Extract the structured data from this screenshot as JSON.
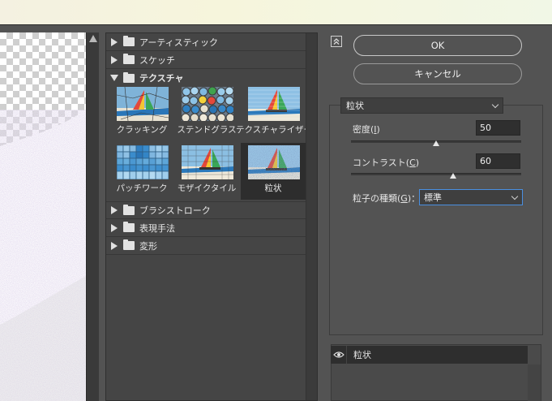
{
  "gallery": {
    "categories_top": [
      {
        "label": "アーティスティック",
        "expanded": false
      },
      {
        "label": "スケッチ",
        "expanded": false
      },
      {
        "label": "テクスチャ",
        "expanded": true
      }
    ],
    "thumbnails": [
      {
        "label": "クラッキング",
        "selected": false
      },
      {
        "label": "ステンドグラス",
        "selected": false
      },
      {
        "label": "テクスチャライザー",
        "selected": false
      },
      {
        "label": "パッチワーク",
        "selected": false
      },
      {
        "label": "モザイクタイル",
        "selected": false
      },
      {
        "label": "粒状",
        "selected": true
      }
    ],
    "categories_bottom": [
      {
        "label": "ブラシストローク",
        "expanded": false
      },
      {
        "label": "表現手法",
        "expanded": false
      },
      {
        "label": "変形",
        "expanded": false
      }
    ]
  },
  "buttons": {
    "ok": "OK",
    "cancel": "キャンセル"
  },
  "settings": {
    "filter_name": "粒状",
    "density": {
      "label": "密度(",
      "key": "I",
      "suffix": ")",
      "value": "50",
      "level": 50,
      "max": 100
    },
    "contrast": {
      "label": "コントラスト(",
      "key": "C",
      "suffix": ")",
      "value": "60",
      "level": 60,
      "max": 100
    },
    "grain_type": {
      "label": "粒子の種類(",
      "key": "G",
      "suffix": ")：",
      "value": "標準"
    }
  },
  "layers": {
    "item": "粒状"
  },
  "colors": {
    "panel": "#535353",
    "gallery": "#454545",
    "selected": "#2d2d2d",
    "focus": "#4a8fe0"
  }
}
